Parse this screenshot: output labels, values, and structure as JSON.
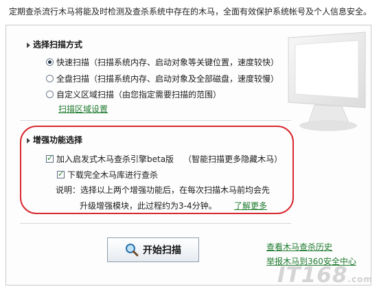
{
  "intro_text": "定期查杀流行木马将能及时检测及查杀系统中存在的木马，全面有效保护系统帐号及个人信息安全。",
  "scan_section": {
    "title": "选择扫描方式",
    "options": [
      {
        "label": "快速扫描（扫描系统内存、启动对象等关键位置，速度较快）",
        "selected": true
      },
      {
        "label": "全盘扫描（扫描系统内存、启动对象及全部磁盘，速度较慢）",
        "selected": false
      },
      {
        "label": "自定义区域扫描（由您指定需要扫描的范围）",
        "selected": false
      }
    ],
    "area_link": "扫描区域设置"
  },
  "enhance_section": {
    "title": "增强功能选择",
    "cloud_engine": {
      "label": "加入启发式木马查杀引擎beta版",
      "note": "（智能扫描更多隐藏木马）",
      "checked": true
    },
    "full_library": {
      "label": "下载完全木马库进行查杀",
      "checked": true
    },
    "explain_line1": "说明：选择以上两个增强功能后，在每次扫描木马前均会先",
    "explain_line2": "升级增强模块，此过程约为3-4分钟。",
    "learn_more": "了解更多"
  },
  "start_button": "开始扫描",
  "links": {
    "history": "查看木马查杀历史",
    "report": "举报木马到360安全中心"
  },
  "watermark": {
    "main": "IT168",
    "suffix": ".com"
  },
  "colors": {
    "accent_link": "#1e7a2e",
    "highlight_border": "#d7262d"
  },
  "icons": {
    "start": "magnifier-icon",
    "section_marker": "triangle-right-icon",
    "decor": "monitor-icon"
  }
}
